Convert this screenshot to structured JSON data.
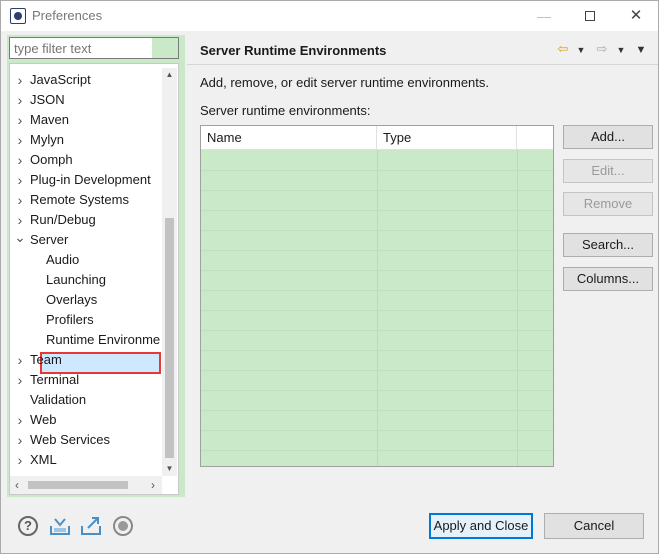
{
  "window": {
    "title": "Preferences",
    "controls": {
      "minimize": "—",
      "maximize": "",
      "close": "✕"
    }
  },
  "sidebar": {
    "filter_placeholder": "type filter text",
    "items": [
      {
        "label": "JavaScript",
        "expander": "collapsed"
      },
      {
        "label": "JSON",
        "expander": "collapsed"
      },
      {
        "label": "Maven",
        "expander": "collapsed"
      },
      {
        "label": "Mylyn",
        "expander": "collapsed"
      },
      {
        "label": "Oomph",
        "expander": "collapsed"
      },
      {
        "label": "Plug-in Development",
        "expander": "collapsed"
      },
      {
        "label": "Remote Systems",
        "expander": "collapsed"
      },
      {
        "label": "Run/Debug",
        "expander": "collapsed"
      },
      {
        "label": "Server",
        "expander": "expanded"
      },
      {
        "label": "Audio",
        "expander": "none"
      },
      {
        "label": "Launching",
        "expander": "none"
      },
      {
        "label": "Overlays",
        "expander": "none"
      },
      {
        "label": "Profilers",
        "expander": "none"
      },
      {
        "label": "Runtime Environme",
        "expander": "none",
        "selected": true
      },
      {
        "label": "Team",
        "expander": "collapsed"
      },
      {
        "label": "Terminal",
        "expander": "collapsed"
      },
      {
        "label": "Validation",
        "expander": "none"
      },
      {
        "label": "Web",
        "expander": "collapsed"
      },
      {
        "label": "Web Services",
        "expander": "collapsed"
      },
      {
        "label": "XML",
        "expander": "collapsed"
      }
    ]
  },
  "page": {
    "title": "Server Runtime Environments",
    "description": "Add, remove, or edit server runtime environments.",
    "list_label": "Server runtime environments:",
    "columns": [
      "Name",
      "Type"
    ],
    "rows": []
  },
  "buttons": {
    "add": "Add...",
    "edit": "Edit...",
    "remove": "Remove",
    "search": "Search...",
    "columns": "Columns..."
  },
  "footer": {
    "apply_close": "Apply and Close",
    "cancel": "Cancel",
    "help": "?"
  },
  "colors": {
    "accent": "#0078d7",
    "highlight_border": "#e53935",
    "tree_bg": "#c9e9c9",
    "nav_arrow": "#d9a21b"
  }
}
